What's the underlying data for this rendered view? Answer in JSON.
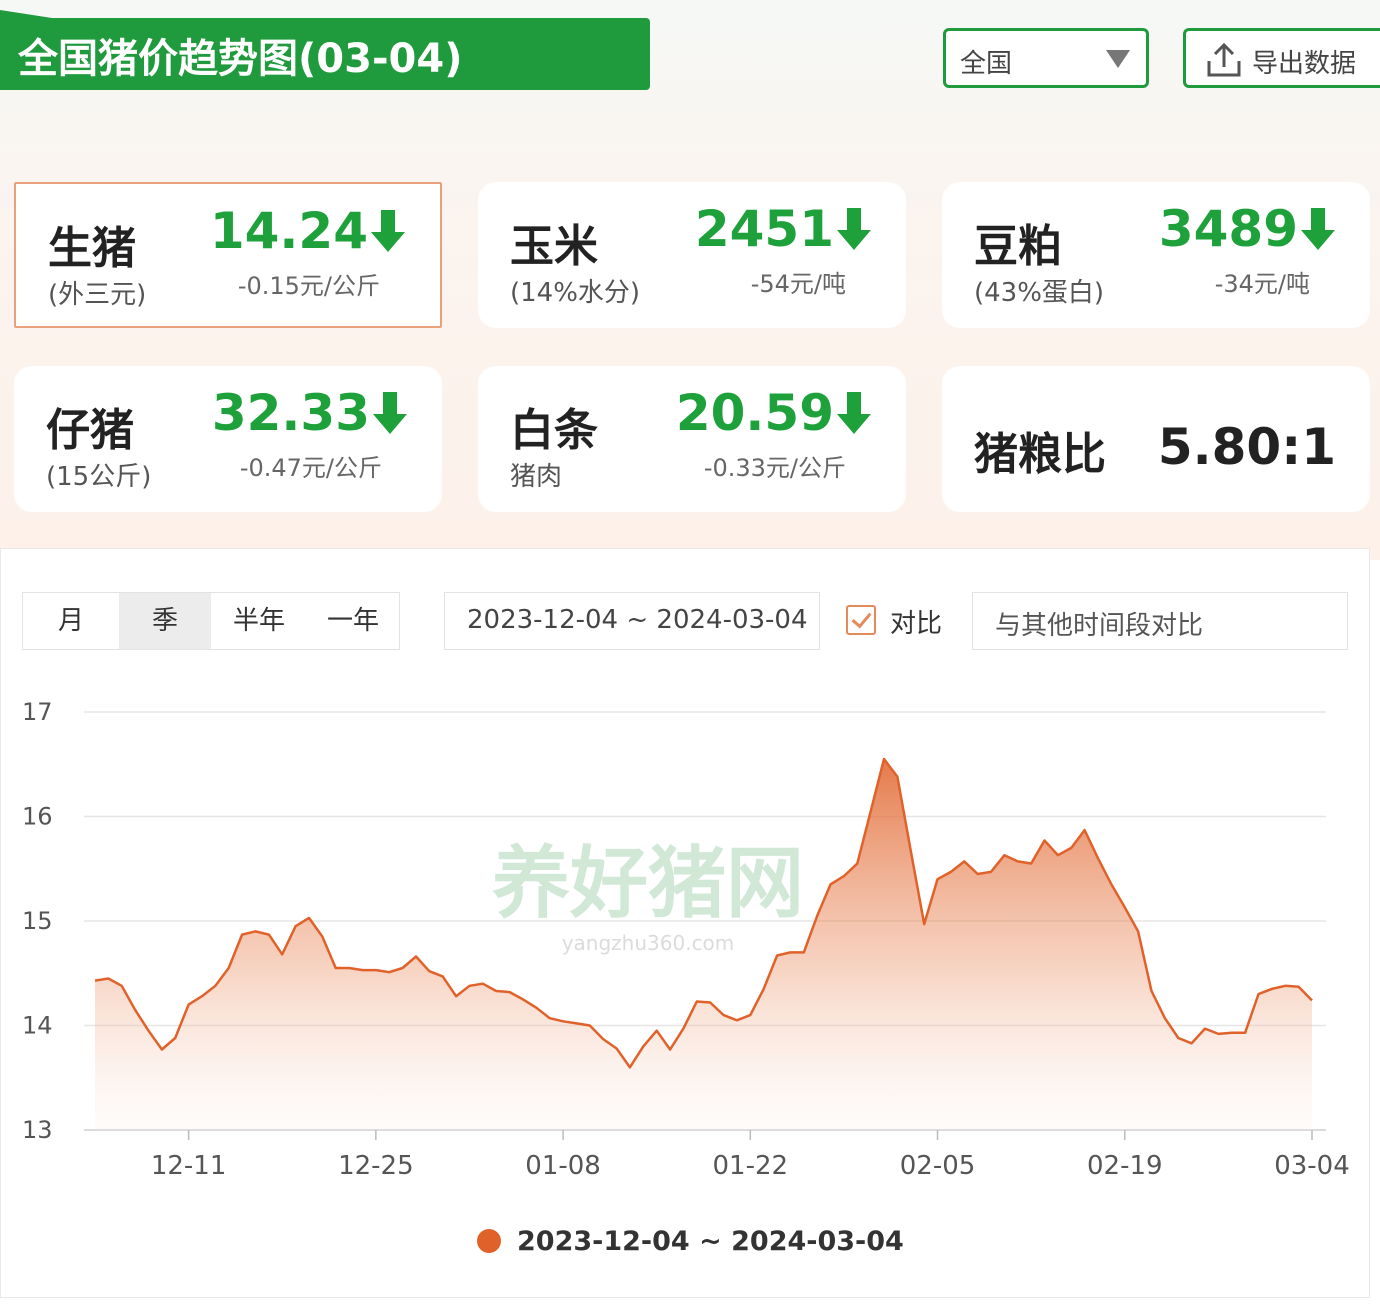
{
  "header": {
    "title": "全国猪价趋势图(03-04)",
    "region": "全国",
    "export_label": "导出数据"
  },
  "cards": [
    {
      "name": "生猪",
      "sub": "(外三元)",
      "price": "14.24",
      "change": "-0.15元/公斤",
      "direction": "down"
    },
    {
      "name": "玉米",
      "sub": "(14%水分)",
      "price": "2451",
      "change": "-54元/吨",
      "direction": "down"
    },
    {
      "name": "豆粕",
      "sub": "(43%蛋白)",
      "price": "3489",
      "change": "-34元/吨",
      "direction": "down"
    },
    {
      "name": "仔猪",
      "sub": "(15公斤)",
      "price": "32.33",
      "change": "-0.47元/公斤",
      "direction": "down"
    },
    {
      "name": "白条",
      "sub": "猪肉",
      "price": "20.59",
      "change": "-0.33元/公斤",
      "direction": "down"
    }
  ],
  "ratio_card": {
    "name": "猪粮比",
    "value": "5.80:1"
  },
  "controls": {
    "tabs": [
      "月",
      "季",
      "半年",
      "一年"
    ],
    "selected_tab": "季",
    "date_range": "2023-12-04 ~ 2024-03-04",
    "compare_label": "对比",
    "compare_checked": true,
    "compare_placeholder": "与其他时间段对比"
  },
  "watermark": {
    "text": "养好猪网",
    "url": "yangzhu360.com"
  },
  "colors": {
    "accent_green": "#1f9a3c",
    "down_green": "#1ea13b",
    "series": "#e0622a",
    "active_border": "#e8a17b"
  },
  "chart_data": {
    "type": "area",
    "title": "",
    "xlabel": "",
    "ylabel": "",
    "ylim": [
      13,
      17
    ],
    "yticks": [
      13,
      14,
      15,
      16,
      17
    ],
    "grid": true,
    "legend_position": "bottom-center",
    "x_tick_labels": [
      "12-11",
      "12-25",
      "01-08",
      "01-22",
      "02-05",
      "02-19",
      "03-04"
    ],
    "x_tick_dates": [
      "2023-12-11",
      "2023-12-25",
      "2024-01-08",
      "2024-01-22",
      "2024-02-05",
      "2024-02-19",
      "2024-03-04"
    ],
    "x_range": [
      "2023-12-04",
      "2024-03-04"
    ],
    "series": [
      {
        "name": "2023-12-04 ~ 2024-03-04",
        "color": "#e0622a",
        "points": [
          [
            "2023-12-04",
            14.43
          ],
          [
            "2023-12-05",
            14.45
          ],
          [
            "2023-12-06",
            14.38
          ],
          [
            "2023-12-07",
            14.15
          ],
          [
            "2023-12-08",
            13.95
          ],
          [
            "2023-12-09",
            13.77
          ],
          [
            "2023-12-10",
            13.88
          ],
          [
            "2023-12-11",
            14.2
          ],
          [
            "2023-12-12",
            14.28
          ],
          [
            "2023-12-13",
            14.38
          ],
          [
            "2023-12-14",
            14.55
          ],
          [
            "2023-12-15",
            14.87
          ],
          [
            "2023-12-16",
            14.9
          ],
          [
            "2023-12-17",
            14.87
          ],
          [
            "2023-12-18",
            14.68
          ],
          [
            "2023-12-19",
            14.95
          ],
          [
            "2023-12-20",
            15.03
          ],
          [
            "2023-12-21",
            14.85
          ],
          [
            "2023-12-22",
            14.55
          ],
          [
            "2023-12-23",
            14.55
          ],
          [
            "2023-12-24",
            14.53
          ],
          [
            "2023-12-25",
            14.53
          ],
          [
            "2023-12-26",
            14.51
          ],
          [
            "2023-12-27",
            14.55
          ],
          [
            "2023-12-28",
            14.66
          ],
          [
            "2023-12-29",
            14.52
          ],
          [
            "2023-12-30",
            14.47
          ],
          [
            "2023-12-31",
            14.28
          ],
          [
            "2024-01-01",
            14.38
          ],
          [
            "2024-01-02",
            14.4
          ],
          [
            "2024-01-03",
            14.33
          ],
          [
            "2024-01-04",
            14.32
          ],
          [
            "2024-01-05",
            14.25
          ],
          [
            "2024-01-06",
            14.17
          ],
          [
            "2024-01-07",
            14.07
          ],
          [
            "2024-01-08",
            14.04
          ],
          [
            "2024-01-09",
            14.02
          ],
          [
            "2024-01-10",
            14.0
          ],
          [
            "2024-01-11",
            13.87
          ],
          [
            "2024-01-12",
            13.78
          ],
          [
            "2024-01-13",
            13.6
          ],
          [
            "2024-01-14",
            13.8
          ],
          [
            "2024-01-15",
            13.95
          ],
          [
            "2024-01-16",
            13.77
          ],
          [
            "2024-01-17",
            13.97
          ],
          [
            "2024-01-18",
            14.23
          ],
          [
            "2024-01-19",
            14.22
          ],
          [
            "2024-01-20",
            14.1
          ],
          [
            "2024-01-21",
            14.05
          ],
          [
            "2024-01-22",
            14.1
          ],
          [
            "2024-01-23",
            14.35
          ],
          [
            "2024-01-24",
            14.67
          ],
          [
            "2024-01-25",
            14.7
          ],
          [
            "2024-01-26",
            14.7
          ],
          [
            "2024-01-27",
            15.05
          ],
          [
            "2024-01-28",
            15.35
          ],
          [
            "2024-01-29",
            15.43
          ],
          [
            "2024-01-30",
            15.55
          ],
          [
            "2024-01-31",
            16.05
          ],
          [
            "2024-02-01",
            16.55
          ],
          [
            "2024-02-02",
            16.38
          ],
          [
            "2024-02-03",
            15.67
          ],
          [
            "2024-02-04",
            14.97
          ],
          [
            "2024-02-05",
            15.4
          ],
          [
            "2024-02-06",
            15.47
          ],
          [
            "2024-02-07",
            15.57
          ],
          [
            "2024-02-08",
            15.45
          ],
          [
            "2024-02-09",
            15.47
          ],
          [
            "2024-02-10",
            15.63
          ],
          [
            "2024-02-11",
            15.57
          ],
          [
            "2024-02-12",
            15.55
          ],
          [
            "2024-02-13",
            15.77
          ],
          [
            "2024-02-14",
            15.63
          ],
          [
            "2024-02-15",
            15.7
          ],
          [
            "2024-02-16",
            15.87
          ],
          [
            "2024-02-17",
            15.6
          ],
          [
            "2024-02-18",
            15.35
          ],
          [
            "2024-02-19",
            15.13
          ],
          [
            "2024-02-20",
            14.9
          ],
          [
            "2024-02-21",
            14.33
          ],
          [
            "2024-02-22",
            14.07
          ],
          [
            "2024-02-23",
            13.88
          ],
          [
            "2024-02-24",
            13.83
          ],
          [
            "2024-02-25",
            13.97
          ],
          [
            "2024-02-26",
            13.92
          ],
          [
            "2024-02-27",
            13.93
          ],
          [
            "2024-02-28",
            13.93
          ],
          [
            "2024-02-29",
            14.3
          ],
          [
            "2024-03-01",
            14.35
          ],
          [
            "2024-03-02",
            14.38
          ],
          [
            "2024-03-03",
            14.37
          ],
          [
            "2024-03-04",
            14.24
          ]
        ]
      }
    ]
  }
}
